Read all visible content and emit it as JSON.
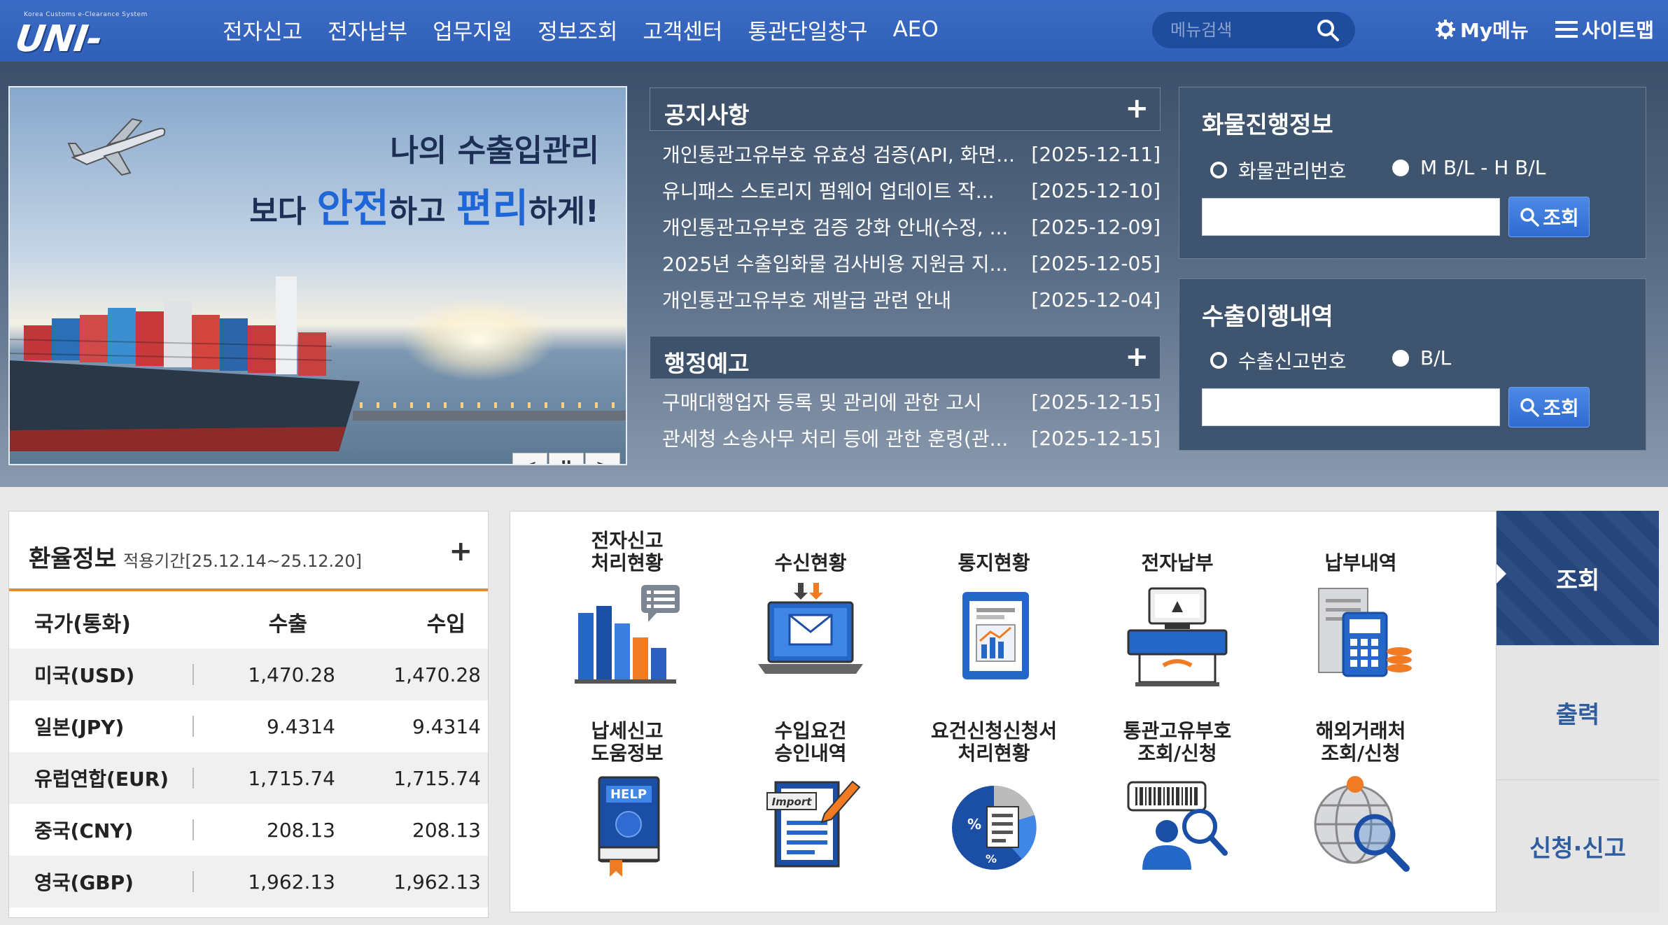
{
  "header": {
    "logo_small": "Korea Customs e-Clearance System",
    "logo_main": "UNI-PASS",
    "nav": [
      "전자신고",
      "전자납부",
      "업무지원",
      "정보조회",
      "고객센터",
      "통관단일창구",
      "AEO"
    ],
    "search_placeholder": "메뉴검색",
    "my_menu": "My메뉴",
    "sitemap": "사이트맵"
  },
  "banner": {
    "line1": "나의 수출입관리",
    "line2_pre": "보다 ",
    "line2_hl1": "안전",
    "line2_mid": "하고 ",
    "line2_hl2": "편리",
    "line2_post": "하게!",
    "prev": "<",
    "pause": "II",
    "next": ">"
  },
  "notice": {
    "title": "공지사항",
    "plus": "+",
    "items": [
      {
        "title": "개인통관고유부호 유효성 검증(API, 화면...",
        "date": "[2025-12-11]"
      },
      {
        "title": "유니패스 스토리지 펌웨어 업데이트 작...",
        "date": "[2025-12-10]"
      },
      {
        "title": "개인통관고유부호 검증 강화 안내(수정, ...",
        "date": "[2025-12-09]"
      },
      {
        "title": "2025년 수출입화물 검사비용 지원금 지...",
        "date": "[2025-12-05]"
      },
      {
        "title": "개인통관고유부호 재발급 관련 안내",
        "date": "[2025-12-04]"
      }
    ]
  },
  "admin": {
    "title": "행정예고",
    "plus": "+",
    "items": [
      {
        "title": "구매대행업자 등록 및 관리에 관한 고시",
        "date": "[2025-12-15]"
      },
      {
        "title": "관세청 소송사무 처리 등에 관한 훈령(관...",
        "date": "[2025-12-15]"
      }
    ]
  },
  "cargo": {
    "title": "화물진행정보",
    "radio1": "화물관리번호",
    "radio2": "M B/L - H B/L",
    "button": "조회"
  },
  "export": {
    "title": "수출이행내역",
    "radio1": "수출신고번호",
    "radio2": "B/L",
    "button": "조회"
  },
  "fx": {
    "title": "환율정보",
    "period": "적용기간[25.12.14~25.12.20]",
    "plus": "+",
    "headers": [
      "국가(통화)",
      "수출",
      "수입"
    ],
    "rows": [
      {
        "country": "미국(USD)",
        "export": "1,470.28",
        "import": "1,470.28"
      },
      {
        "country": "일본(JPY)",
        "export": "9.4314",
        "import": "9.4314"
      },
      {
        "country": "유럽연합(EUR)",
        "export": "1,715.74",
        "import": "1,715.74"
      },
      {
        "country": "중국(CNY)",
        "export": "208.13",
        "import": "208.13"
      },
      {
        "country": "영국(GBP)",
        "export": "1,962.13",
        "import": "1,962.13"
      }
    ]
  },
  "services": [
    {
      "label": "전자신고\n처리현황",
      "icon": "bar-chart-icon"
    },
    {
      "label": "수신현황",
      "icon": "laptop-mail-icon"
    },
    {
      "label": "통지현황",
      "icon": "report-clipboard-icon"
    },
    {
      "label": "전자납부",
      "icon": "payment-terminal-icon"
    },
    {
      "label": "납부내역",
      "icon": "receipt-calculator-icon"
    },
    {
      "label": "납세신고\n도움정보",
      "icon": "help-book-icon"
    },
    {
      "label": "수입요건\n승인내역",
      "icon": "import-document-icon"
    },
    {
      "label": "요건신청신청서\n처리현황",
      "icon": "pie-document-icon"
    },
    {
      "label": "통관고유부호\n조회/신청",
      "icon": "barcode-person-icon"
    },
    {
      "label": "해외거래처\n조회/신청",
      "icon": "globe-search-icon"
    }
  ],
  "side_tabs": [
    "조회",
    "출력",
    "신청·신고"
  ],
  "colors": {
    "header": "#2f5fb7",
    "accent_orange": "#e98b2a",
    "active_tab": "#26477f",
    "button_blue": "#2f6bd0"
  }
}
